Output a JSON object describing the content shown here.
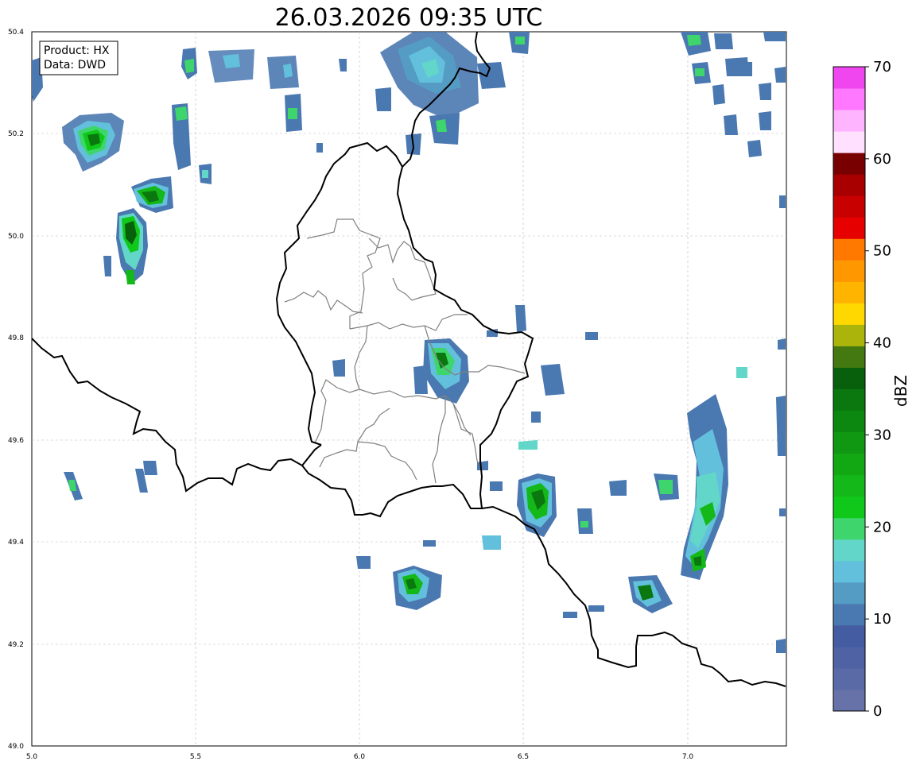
{
  "title": "26.03.2026 09:35 UTC",
  "info_box": {
    "product": "Product: HX",
    "data": "Data: DWD"
  },
  "map": {
    "lon_range": [
      5.0,
      7.3
    ],
    "lat_range": [
      49.0,
      50.4
    ],
    "x_ticks": [
      "5.0",
      "5.5",
      "6.0",
      "6.5",
      "7.0"
    ],
    "y_ticks": [
      "49.0",
      "49.2",
      "49.4",
      "49.6",
      "49.8",
      "50.0",
      "50.2",
      "50.4"
    ]
  },
  "colorbar": {
    "label": "dBZ",
    "tick_labels": [
      "0",
      "10",
      "20",
      "30",
      "40",
      "50",
      "60",
      "70"
    ],
    "colors": [
      "#6672a8",
      "#5a6aa6",
      "#4e62a4",
      "#435ca2",
      "#4a78b0",
      "#559cc4",
      "#62c0dc",
      "#62d6c8",
      "#3ed66c",
      "#10c81a",
      "#14b818",
      "#12a814",
      "#109812",
      "#0c8810",
      "#0a780e",
      "#08600c",
      "#447810",
      "#aab40a",
      "#ffd800",
      "#ffb400",
      "#ff9800",
      "#ff7800",
      "#e60000",
      "#c80000",
      "#a80000",
      "#780000",
      "#ffe0ff",
      "#ffb4ff",
      "#ff78ff",
      "#f046f0"
    ]
  }
}
